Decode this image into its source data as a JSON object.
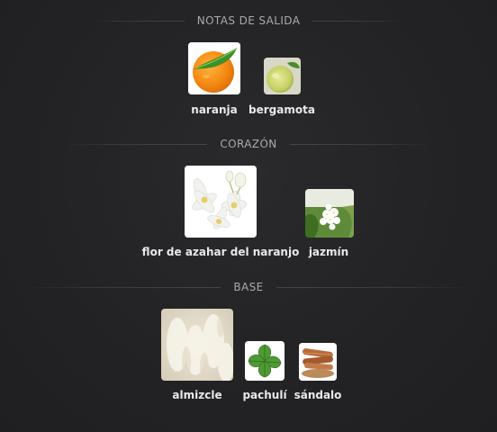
{
  "sections": [
    {
      "title": "NOTAS DE SALIDA",
      "notes": [
        {
          "name": "naranja",
          "icon": "orange-icon"
        },
        {
          "name": "bergamota",
          "icon": "bergamot-icon"
        }
      ]
    },
    {
      "title": "CORAZÓN",
      "notes": [
        {
          "name": "flor de azahar del naranjo",
          "icon": "orange-blossom-icon"
        },
        {
          "name": "jazmín",
          "icon": "jasmine-icon"
        }
      ]
    },
    {
      "title": "BASE",
      "notes": [
        {
          "name": "almizcle",
          "icon": "musk-icon"
        },
        {
          "name": "pachulí",
          "icon": "patchouli-icon"
        },
        {
          "name": "sándalo",
          "icon": "sandalwood-icon"
        }
      ]
    }
  ]
}
